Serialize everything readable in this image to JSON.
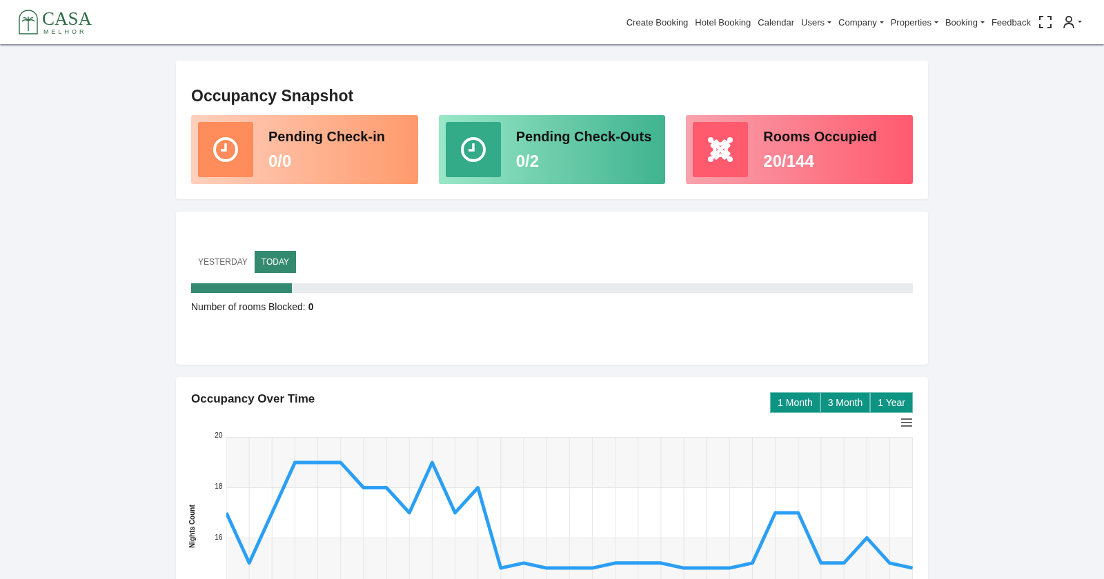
{
  "brand": {
    "name": "CASA",
    "tagline": "MELHOR"
  },
  "nav": [
    {
      "label": "Create Booking",
      "dropdown": false
    },
    {
      "label": "Hotel Booking",
      "dropdown": false
    },
    {
      "label": "Calendar",
      "dropdown": false
    },
    {
      "label": "Users",
      "dropdown": true
    },
    {
      "label": "Company",
      "dropdown": true
    },
    {
      "label": "Properties",
      "dropdown": true
    },
    {
      "label": "Booking",
      "dropdown": true
    },
    {
      "label": "Feedback",
      "dropdown": false
    }
  ],
  "snapshot": {
    "title": "Occupancy Snapshot",
    "cards": [
      {
        "kind": "checkin",
        "label": "Pending Check-in",
        "value": "0/0"
      },
      {
        "kind": "checkout",
        "label": "Pending Check-Outs",
        "value": "0/2"
      },
      {
        "kind": "rooms",
        "label": "Rooms Occupied",
        "value": "20/144"
      }
    ]
  },
  "blocked": {
    "tabs": [
      {
        "label": "YESTERDAY",
        "selected": false
      },
      {
        "label": "TODAY",
        "selected": true
      }
    ],
    "level": 0.14,
    "label": "Number of rooms Blocked:",
    "count": "0"
  },
  "occupancy": {
    "title": "Occupancy Over Time",
    "ranges": [
      "1 Month",
      "3 Month",
      "1 Year"
    ],
    "chart_data": {
      "type": "line",
      "ylabel": "Nights Count",
      "ylim": [
        14,
        20
      ],
      "yticks": [
        16,
        18,
        20
      ],
      "grid": true,
      "series": [
        {
          "color": "#2b9ff5",
          "values": [
            17,
            15,
            17,
            19,
            19,
            19,
            18,
            18,
            17,
            19,
            17,
            18,
            14.8,
            15,
            14.8,
            14.8,
            14.8,
            15,
            15,
            15,
            14.8,
            14.8,
            14.8,
            15,
            17,
            17,
            15,
            15,
            16,
            15,
            14.8
          ]
        }
      ]
    }
  }
}
